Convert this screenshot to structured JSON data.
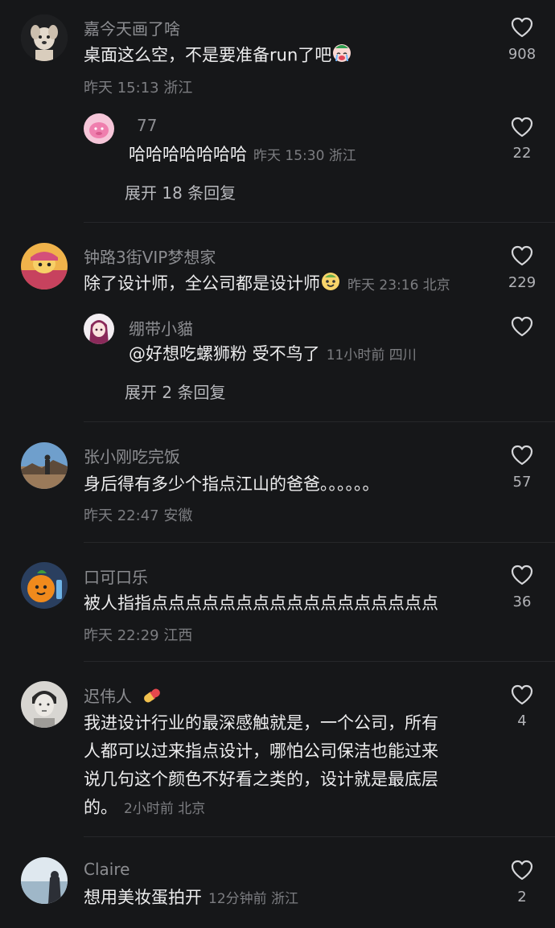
{
  "comments": [
    {
      "username": "嘉今天画了啥",
      "text": "桌面这么空，不是要准备run了吧",
      "emoji": "crying-face",
      "meta": "昨天 15:13 浙江",
      "likes": "908",
      "reply": {
        "username": "77",
        "text": "哈哈哈哈哈哈哈",
        "meta": "昨天 15:30 浙江",
        "likes": "22"
      },
      "expand": "展开 18 条回复"
    },
    {
      "username": "钟路3街VIP梦想家",
      "text": "除了设计师，全公司都是设计师",
      "emoji": "smiling-face",
      "meta": "昨天 23:16 北京",
      "likes": "229",
      "reply": {
        "username": "绷带小貓",
        "text": "@好想吃螺狮粉 受不鸟了",
        "meta": "11小时前 四川",
        "likes": ""
      },
      "expand": "展开 2 条回复"
    },
    {
      "username": "张小刚吃完饭",
      "text": "身后得有多少个指点江山的爸爸。。。。。。",
      "meta": "昨天 22:47 安徽",
      "likes": "57"
    },
    {
      "username": "口可口乐",
      "text": "被人指指点点点点点点点点点点点点点点点点点",
      "meta": "昨天 22:29 江西",
      "likes": "36"
    },
    {
      "username": "迟伟人",
      "username_emoji": "pill",
      "lines": [
        "我进设计行业的最深感触就是，一个公司，所有",
        "人都可以过来指点设计，哪怕公司保洁也能过来",
        "说几句这个颜色不好看之类的，设计就是最底层",
        "的。"
      ],
      "meta": "2小时前 北京",
      "likes": "4"
    },
    {
      "username": "Claire",
      "text": "想用美妆蛋拍开",
      "meta": "12分钟前 浙江",
      "likes": "2"
    }
  ],
  "icons": {
    "like": "heart-outline-icon"
  },
  "colors": {
    "background": "#161719",
    "text": "#ededee",
    "secondary": "#8c8d91"
  }
}
